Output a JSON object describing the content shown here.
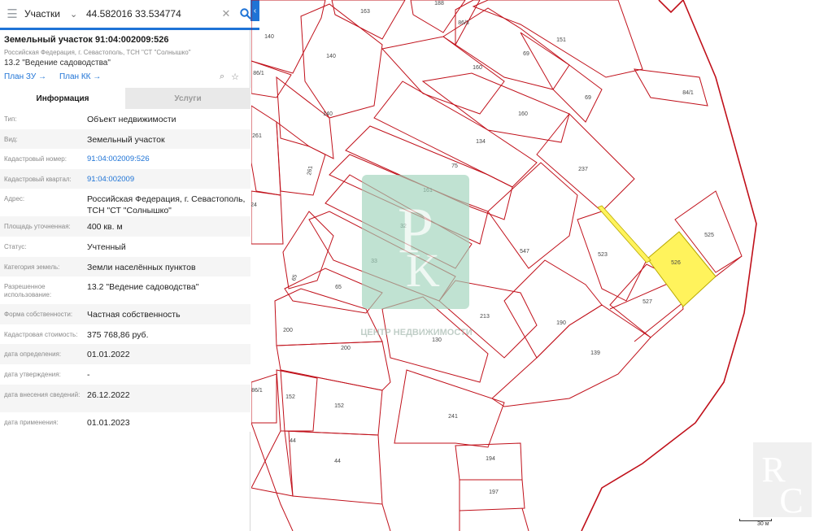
{
  "search": {
    "layer": "Участки",
    "query": "44.582016 33.534774"
  },
  "header": {
    "title": "Земельный участок 91:04:002009:526",
    "address": "Российская Федерация, г. Севастополь, ТСН \"СТ \"Солнышко\"",
    "use": "13.2 \"Ведение садоводства\"",
    "link_zu": "План ЗУ →",
    "link_kk": "План КК →"
  },
  "tabs": {
    "info": "Информация",
    "services": "Услуги"
  },
  "props": [
    {
      "k": "Тип:",
      "v": "Объект недвижимости"
    },
    {
      "k": "Вид:",
      "v": "Земельный участок"
    },
    {
      "k": "Кадастровый номер:",
      "v": "91:04:002009:526",
      "link": true
    },
    {
      "k": "Кадастровый квартал:",
      "v": "91:04:002009",
      "link": true
    },
    {
      "k": "Адрес:",
      "v": "Российская Федерация, г. Севастополь, ТСН \"СТ \"Солнышко\""
    },
    {
      "k": "Площадь уточненная:",
      "v": "400 кв. м"
    },
    {
      "k": "Статус:",
      "v": "Учтенный"
    },
    {
      "k": "Категория земель:",
      "v": "Земли населённых пунктов"
    },
    {
      "k": "Разрешенное использование:",
      "v": "13.2 \"Ведение садоводства\""
    },
    {
      "k": "Форма собственности:",
      "v": "Частная собственность"
    },
    {
      "k": "Кадастровая стоимость:",
      "v": "375 768,86 руб."
    },
    {
      "k": "дата определения:",
      "v": "01.01.2022"
    },
    {
      "k": "дата утверждения:",
      "v": "-"
    },
    {
      "k": "дата внесения сведений:",
      "v": "26.12.2022"
    },
    {
      "k": "дата применения:",
      "v": "01.01.2023"
    }
  ],
  "map": {
    "parcel_labels": [
      "163",
      "188",
      "86/3",
      "140",
      "140",
      "151",
      "69",
      "160",
      "86/1",
      "69",
      "160",
      "140",
      "134",
      "84/1",
      "261",
      "75",
      "237",
      "261",
      "161",
      "24",
      "32",
      "547",
      "523",
      "525",
      "526",
      "65",
      "65",
      "33",
      "527",
      "213",
      "200",
      "130",
      "190",
      "200",
      "139",
      "86/1",
      "152",
      "152",
      "241",
      "44",
      "44",
      "194",
      "197"
    ],
    "watermark": "ЦЕНТР НЕДВИЖИМОСТИ",
    "scale": "30 м",
    "colors": {
      "boundary": "#c0101a",
      "parcel": "#c0101a",
      "selected": "#fff35c"
    }
  }
}
